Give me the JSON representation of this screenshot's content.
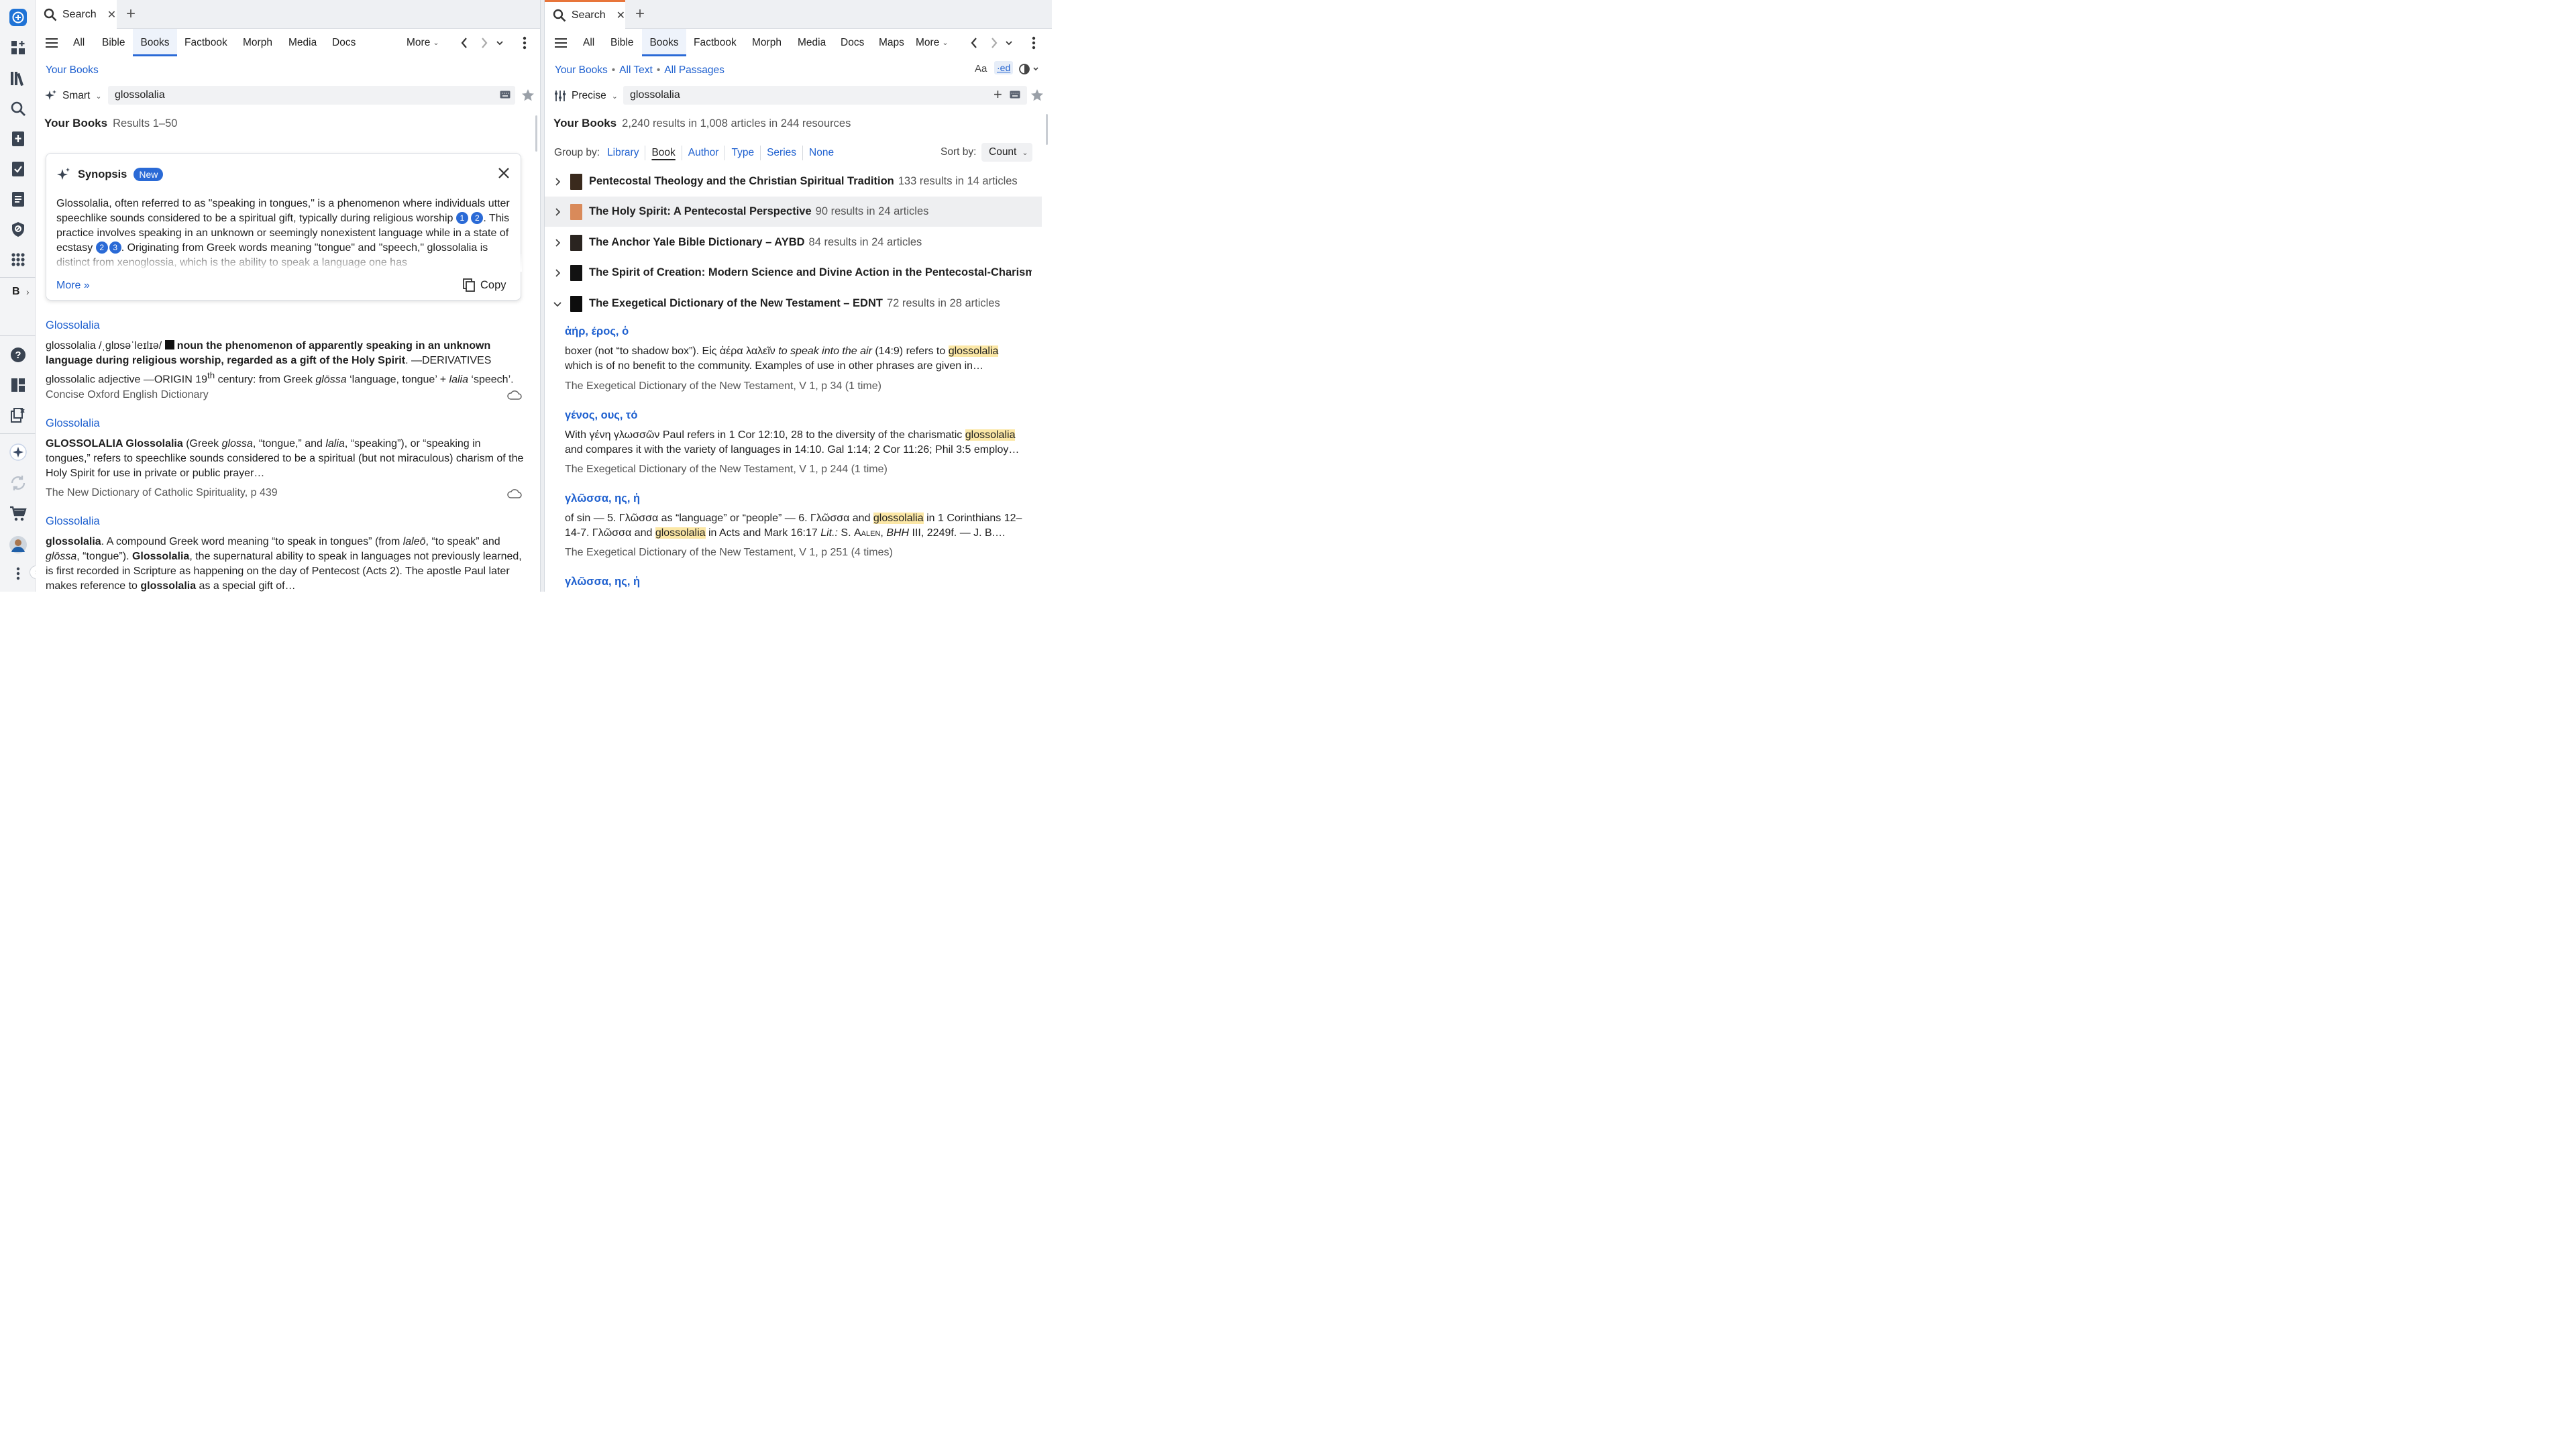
{
  "rail": {
    "items": [
      "logos-home-icon",
      "dashboard-add-icon",
      "library-icon",
      "search-icon",
      "bible-add-icon",
      "checklist-icon",
      "document-icon",
      "shield-icon",
      "apps-grid-icon"
    ],
    "b_label": "B",
    "bottom": [
      "help-icon",
      "layouts-icon",
      "close-panels-icon",
      "ai-sparkle-icon",
      "sync-icon",
      "cart-icon",
      "user-avatar",
      "more-vertical-icon"
    ]
  },
  "left": {
    "tab": {
      "label": "Search"
    },
    "nav": {
      "all": "All",
      "bible": "Bible",
      "books": "Books",
      "factbook": "Factbook",
      "morph": "Morph",
      "media": "Media",
      "docs": "Docs",
      "more": "More"
    },
    "breadcrumb": "Your Books",
    "mode": "Smart",
    "query": "glossolalia",
    "results_title": "Your Books",
    "results_range": "Results 1–50",
    "synopsis": {
      "title": "Synopsis",
      "badge": "New",
      "text_1": "Glossolalia, often referred to as \"speaking in tongues,\" is a phenomenon where individuals utter speechlike sounds considered to be a spiritual gift, typically during religious worship ",
      "cite_1": "1",
      "cite_2": "2",
      "text_2": ". This practice involves speaking in an unknown or seemingly nonexistent language while in a state of ecstasy ",
      "cite_3": "2",
      "cite_4": "3",
      "text_3": ". Originating from Greek words meaning \"tongue\" and \"speech,\" glossolalia is distinct from xenoglossia, which is the ability to speak a language one has",
      "more": "More »",
      "copy": "Copy"
    },
    "entries": [
      {
        "title": "Glossolalia",
        "pron": "glossolalia /ˌglɒsəˈleɪlɪə/ ",
        "def_bold": "noun the phenomenon of apparently speaking in an unknown language during religious worship, regarded as a gift of the Holy Spirit",
        "derivs_label": ". —DERIVATIVES",
        "line3_a": "glossolalic adjective —",
        "origin_label": "ORIGIN",
        "line3_b": " 19",
        "line3_sup": "th",
        "line3_c": " century: from Greek ",
        "line3_it1": "glōssa",
        "line3_d": " ‘language, tongue’ + ",
        "line3_it2": "lalia",
        "line3_e": " ‘speech’.",
        "source": "Concise Oxford English Dictionary"
      },
      {
        "title": "Glossolalia",
        "b1": "GLOSSOLALIA Glossolalia",
        "t1": " (Greek ",
        "i1": "glossa",
        "t2": ", “tongue,” and ",
        "i2": "lalia",
        "t3": ", “speaking”), or “speaking in tongues,” refers to speechlike sounds considered to be a spiritual (but not miraculous) charism of the Holy Spirit for use in private or public prayer…",
        "source": "The New Dictionary of Catholic Spirituality, p 439"
      },
      {
        "title": "Glossolalia",
        "b1": "glossolalia",
        "t1": ". A compound Greek word meaning “to speak in tongues” (from ",
        "i1": "laleō",
        "t2": ", “to speak” and ",
        "i2": "glōssa",
        "t3": ", “tongue”). ",
        "b2": "Glossolalia",
        "t4": ", the supernatural ability to speak in languages not previously learned, is first recorded in Scripture as happening on the day of Pentecost (Acts 2). The apostle Paul later makes reference to ",
        "b3": "glossolalia",
        "t5": " as a special gift of…"
      }
    ]
  },
  "right": {
    "tab": {
      "label": "Search"
    },
    "nav": {
      "all": "All",
      "bible": "Bible",
      "books": "Books",
      "factbook": "Factbook",
      "morph": "Morph",
      "media": "Media",
      "docs": "Docs",
      "maps": "Maps",
      "more": "More"
    },
    "breadcrumb": {
      "a": "Your Books",
      "b": "All Text",
      "c": "All Passages"
    },
    "view_icons": {
      "aa": "Aa",
      "ed": "·ed"
    },
    "mode": "Precise",
    "query": "glossolalia",
    "results_title": "Your Books",
    "results_summary": "2,240 results in 1,008 articles in 244 resources",
    "group_by_label": "Group by:",
    "group_by": [
      "Library",
      "Book",
      "Author",
      "Type",
      "Series",
      "None"
    ],
    "sort_by_label": "Sort by:",
    "sort_by_value": "Count",
    "books": [
      {
        "title": "Pentecostal Theology and the Christian Spiritual Tradition",
        "count": "133 results in 14 articles",
        "cover": "#3a2a1d"
      },
      {
        "title": "The Holy Spirit: A Pentecostal Perspective",
        "count": "90 results in 24 articles",
        "cover": "#d98a5a"
      },
      {
        "title": "The Anchor Yale Bible Dictionary – AYBD",
        "count": "84 results in 24 articles",
        "cover": "#2a2420"
      },
      {
        "title": "The Spirit of Creation: Modern Science and Divine Action in the Pentecostal-Charisma…",
        "count": "",
        "cover": "#121212"
      },
      {
        "title": "The Exegetical Dictionary of the New Testament – EDNT",
        "count": "72 results in 28 articles",
        "cover": "#0d0d0d"
      }
    ],
    "articles": [
      {
        "head": "ἀήρ, έρος, ὁ",
        "l1a": "boxer (not “to shadow box”). Εἰς ἀέρα λαλεῖν ",
        "l1i": "to speak into the air",
        "l1b": " (14:9) refers to ",
        "hit": "glossolalia",
        "l2": "which is of no benefit to the community. Examples of use in other phrases are given in…",
        "source": "The Exegetical Dictionary of the New Testament, V 1, p 34 (1 time)"
      },
      {
        "head": "γένος, ους, τό",
        "l1a": "With γένη γλωσσῶν Paul refers in 1 Cor 12:10, 28 to the diversity of the charismatic ",
        "hit": "glossolalia",
        "l2": "and compares it with the variety of languages in 14:10. Gal 1:14; 2 Cor 11:26; Phil 3:5 employ…",
        "source": "The Exegetical Dictionary of the New Testament, V 1, p 244 (1 time)"
      },
      {
        "head": "γλῶσσα, ης, ἡ",
        "l1a": "of sin — 5. Γλῶσσα as “language” or “people” — 6. Γλῶσσα and ",
        "hit": "glossolalia",
        "l1b": " in 1 Corinthians 12–",
        "l2a": "14-7. Γλῶσσα and ",
        "hit2": "glossolalia",
        "l2b": " in Acts and Mark 16:17 ",
        "l2i": "Lit.:",
        "l2c": " S. ",
        "l2sc": "Aalen",
        "l2d": ", ",
        "l2i2": "BHH",
        "l2e": " III, 2249f. — J. B.…",
        "source": "The Exegetical Dictionary of the New Testament, V 1, p 251 (4 times)"
      },
      {
        "head": "γλῶσσα, ης, ἡ"
      }
    ]
  }
}
